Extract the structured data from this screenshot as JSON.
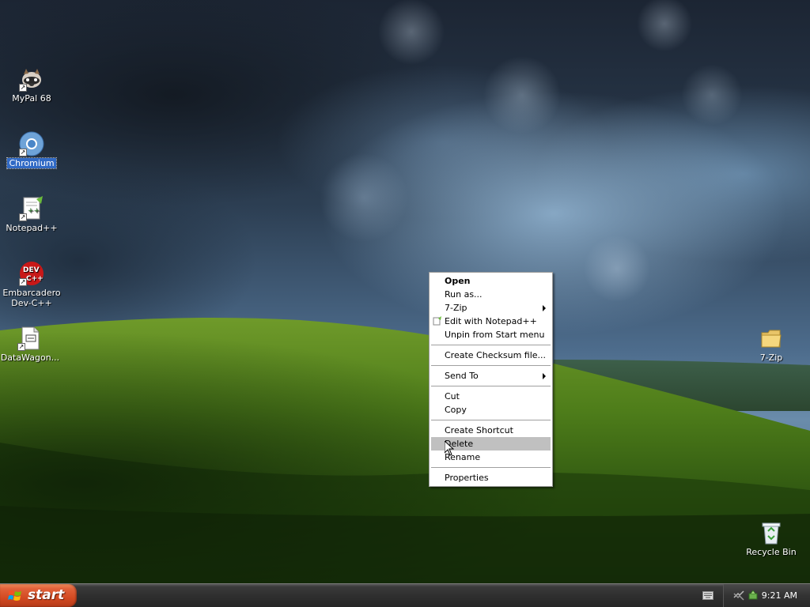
{
  "desktop": {
    "icons": [
      {
        "label": "MyPal 68",
        "icon": "mypal-raccoon-icon"
      },
      {
        "label": "Chromium",
        "icon": "chromium-icon",
        "selected": true
      },
      {
        "label": "Notepad++",
        "icon": "notepadpp-icon"
      },
      {
        "label": "Embarcadero Dev-C++",
        "line1": "Embarcadero",
        "line2": "Dev-C++",
        "icon": "devcpp-icon"
      },
      {
        "label": "DataWagon...",
        "icon": "document-icon"
      },
      {
        "label": "7-Zip",
        "icon": "folder-icon"
      },
      {
        "label": "Recycle Bin",
        "icon": "recycle-bin-icon"
      }
    ]
  },
  "context_menu": {
    "items": [
      {
        "label": "Open",
        "bold": true
      },
      {
        "label": "Run as..."
      },
      {
        "label": "7-Zip",
        "submenu": true
      },
      {
        "label": "Edit with Notepad++",
        "icon": "notepadpp-small-icon"
      },
      {
        "label": "Unpin from Start menu"
      },
      {
        "label": "Create Checksum file..."
      },
      {
        "label": "Send To",
        "submenu": true
      },
      {
        "label": "Cut"
      },
      {
        "label": "Copy"
      },
      {
        "label": "Create Shortcut"
      },
      {
        "label": "Delete",
        "highlighted": true
      },
      {
        "label": "Rename"
      },
      {
        "label": "Properties"
      }
    ]
  },
  "taskbar": {
    "start_label": "start",
    "clock": "9:21 AM"
  },
  "colors": {
    "selection_blue": "#316ac5",
    "menu_highlight": "#c0c0c0",
    "start_orange": "#d34a22"
  }
}
